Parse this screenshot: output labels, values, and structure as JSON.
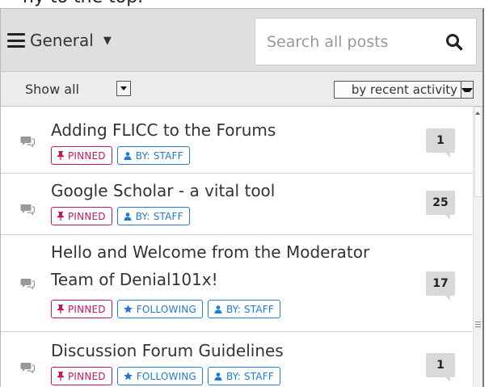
{
  "top_partial_text": "ny to the top.",
  "header": {
    "menu_label": "General",
    "search_placeholder": "Search all posts"
  },
  "filter": {
    "show_label": "Show all",
    "sort_label": "by recent activity"
  },
  "threads": [
    {
      "title": "Adding FLICC to the Forums",
      "badges": [
        "PINNED",
        "BY: STAFF"
      ],
      "count": "1"
    },
    {
      "title": "Google Scholar - a vital tool",
      "badges": [
        "PINNED",
        "BY: STAFF"
      ],
      "count": "25"
    },
    {
      "title_line1": "Hello and Welcome from the Moderator",
      "title_line2": "Team of Denial101x!",
      "badges": [
        "PINNED",
        "FOLLOWING",
        "BY: STAFF"
      ],
      "count": "17"
    },
    {
      "title": "Discussion Forum Guidelines",
      "badges": [
        "PINNED",
        "FOLLOWING",
        "BY: STAFF"
      ],
      "count": "1"
    }
  ],
  "colors": {
    "pinned": "#c2185b",
    "following": "#1e7ad8",
    "staff": "#1e7ad8",
    "count_bg": "#d9d9d9",
    "header_bg": "#dfdfdf"
  },
  "icons": {
    "menu": "hamburger-icon",
    "search": "search-icon",
    "thread": "chat-bubble-icon",
    "pinned": "pin-icon",
    "following": "star-icon",
    "staff": "person-icon"
  }
}
